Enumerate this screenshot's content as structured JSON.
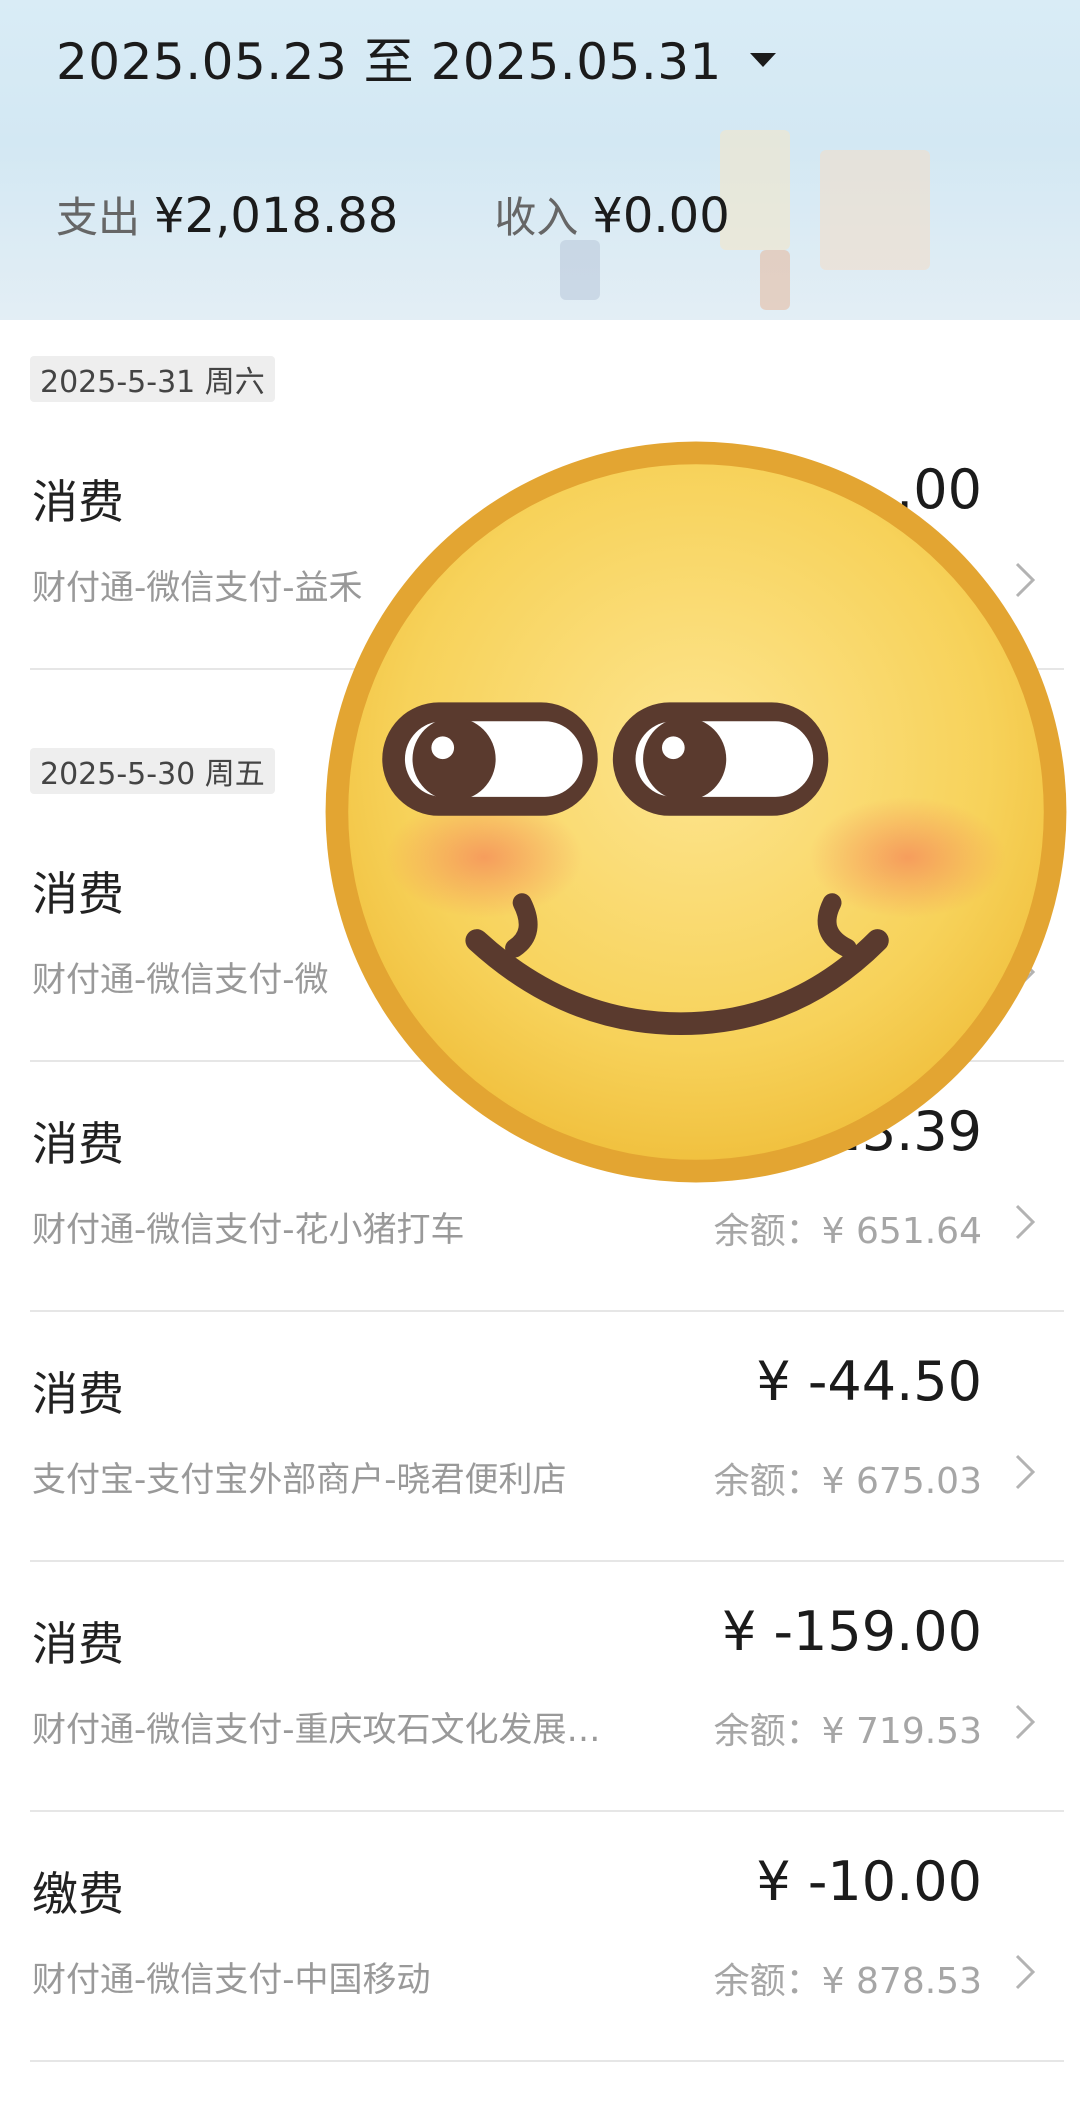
{
  "header": {
    "date_range": "2025.05.23 至 2025.05.31",
    "expense_label": "支出",
    "expense_value": "¥2,018.88",
    "income_label": "收入",
    "income_value": "¥0.00"
  },
  "groups": [
    {
      "date": "2025-5-31 周六",
      "rows": [
        {
          "type": "消费",
          "merchant": "财付通-微信支付-益禾",
          "amount": ".00",
          "balance": ""
        }
      ]
    },
    {
      "date": "2025-5-30 周五",
      "rows": [
        {
          "type": "消费",
          "merchant": "财付通-微信支付-微",
          "amount": "",
          "balance": ""
        },
        {
          "type": "消费",
          "merchant": "财付通-微信支付-花小猪打车",
          "amount": "23.39",
          "balance": "余额：¥ 651.64"
        },
        {
          "type": "消费",
          "merchant": "支付宝-支付宝外部商户-晓君便利店",
          "amount": "¥ -44.50",
          "balance": "余额：¥ 675.03"
        },
        {
          "type": "消费",
          "merchant": "财付通-微信支付-重庆攻石文化发展…",
          "amount": "¥ -159.00",
          "balance": "余额：¥ 719.53"
        },
        {
          "type": "缴费",
          "merchant": "财付通-微信支付-中国移动",
          "amount": "¥ -10.00",
          "balance": "余额：¥ 878.53"
        }
      ]
    }
  ],
  "overlay": {
    "icon": "smirk-emoji-icon",
    "color_face": "#f6cf4e",
    "color_rim": "#e3a532"
  },
  "colors": {
    "header_bg": "#d9ecf6",
    "tag_bg": "#eeeeee",
    "text_muted": "#999999"
  }
}
